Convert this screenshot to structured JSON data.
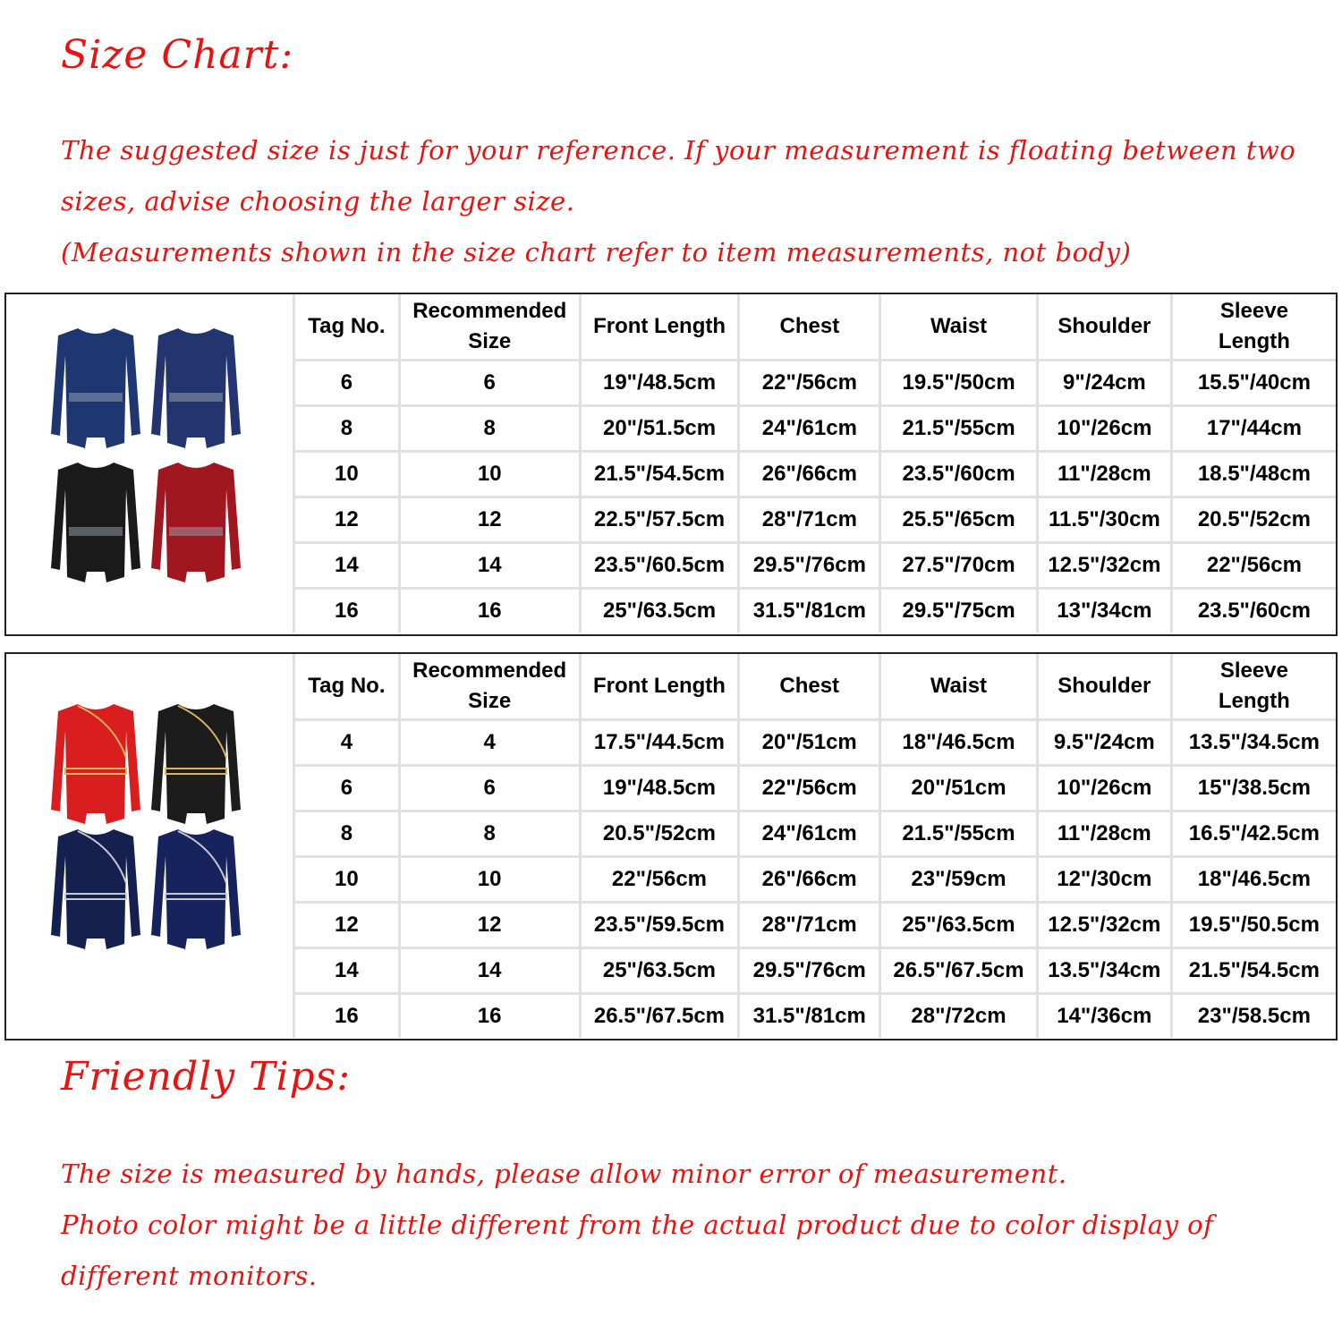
{
  "header": {
    "title": "Size Chart:",
    "intro_lines": [
      "The suggested size is just for your reference. If your measurement is floating between two",
      "sizes, advise choosing the larger size.",
      "(Measurements shown in the size chart refer to item measurements, not body)"
    ]
  },
  "colors": {
    "accent_red": "#e8120f",
    "grid_line": "#e0e0e0",
    "border": "#222222"
  },
  "tables": [
    {
      "product_image": "cold-shoulder sequin long-sleeve leotards in navy, navy (back), black, burgundy",
      "headers": [
        "Tag No.",
        "Recommended Size",
        "Front Length",
        "Chest",
        "Waist",
        "Shoulder",
        "Sleeve Length"
      ],
      "header_lines": [
        [
          "Tag No."
        ],
        [
          "Recommended",
          "Size"
        ],
        [
          "Front Length"
        ],
        [
          "Chest"
        ],
        [
          "Waist"
        ],
        [
          "Shoulder"
        ],
        [
          "Sleeve",
          "Length"
        ]
      ],
      "rows": [
        [
          "6",
          "6",
          "19\"/48.5cm",
          "22\"/56cm",
          "19.5\"/50cm",
          "9\"/24cm",
          "15.5\"/40cm"
        ],
        [
          "8",
          "8",
          "20\"/51.5cm",
          "24\"/61cm",
          "21.5\"/55cm",
          "10\"/26cm",
          "17\"/44cm"
        ],
        [
          "10",
          "10",
          "21.5\"/54.5cm",
          "26\"/66cm",
          "23.5\"/60cm",
          "11\"/28cm",
          "18.5\"/48cm"
        ],
        [
          "12",
          "12",
          "22.5\"/57.5cm",
          "28\"/71cm",
          "25.5\"/65cm",
          "11.5\"/30cm",
          "20.5\"/52cm"
        ],
        [
          "14",
          "14",
          "23.5\"/60.5cm",
          "29.5\"/76cm",
          "27.5\"/70cm",
          "12.5\"/32cm",
          "22\"/56cm"
        ],
        [
          "16",
          "16",
          "25\"/63.5cm",
          "31.5\"/81cm",
          "29.5\"/75cm",
          "13\"/34cm",
          "23.5\"/60cm"
        ]
      ]
    },
    {
      "product_image": "long-sleeve leotards with gold/silver piping in red, black, navy, navy (back)",
      "headers": [
        "Tag No.",
        "Recommended Size",
        "Front Length",
        "Chest",
        "Waist",
        "Shoulder",
        "Sleeve Length"
      ],
      "header_lines": [
        [
          "Tag No."
        ],
        [
          "Recommended",
          "Size"
        ],
        [
          "Front Length"
        ],
        [
          "Chest"
        ],
        [
          "Waist"
        ],
        [
          "Shoulder"
        ],
        [
          "Sleeve",
          "Length"
        ]
      ],
      "rows": [
        [
          "4",
          "4",
          "17.5\"/44.5cm",
          "20\"/51cm",
          "18\"/46.5cm",
          "9.5\"/24cm",
          "13.5\"/34.5cm"
        ],
        [
          "6",
          "6",
          "19\"/48.5cm",
          "22\"/56cm",
          "20\"/51cm",
          "10\"/26cm",
          "15\"/38.5cm"
        ],
        [
          "8",
          "8",
          "20.5\"/52cm",
          "24\"/61cm",
          "21.5\"/55cm",
          "11\"/28cm",
          "16.5\"/42.5cm"
        ],
        [
          "10",
          "10",
          "22\"/56cm",
          "26\"/66cm",
          "23\"/59cm",
          "12\"/30cm",
          "18\"/46.5cm"
        ],
        [
          "12",
          "12",
          "23.5\"/59.5cm",
          "28\"/71cm",
          "25\"/63.5cm",
          "12.5\"/32cm",
          "19.5\"/50.5cm"
        ],
        [
          "14",
          "14",
          "25\"/63.5cm",
          "29.5\"/76cm",
          "26.5\"/67.5cm",
          "13.5\"/34cm",
          "21.5\"/54.5cm"
        ],
        [
          "16",
          "16",
          "26.5\"/67.5cm",
          "31.5\"/81cm",
          "28\"/72cm",
          "14\"/36cm",
          "23\"/58.5cm"
        ]
      ]
    }
  ],
  "tips": {
    "title": "Friendly Tips:",
    "lines": [
      "The size is measured by hands, please allow minor error of measurement.",
      "Photo color might be a little different from the actual product due to color display of",
      "different monitors."
    ]
  },
  "garments": {
    "set1": [
      "#1f3770",
      "#23346e",
      "#1a1a1a",
      "#a01720"
    ],
    "set2": [
      "#d81e1e",
      "#1c1c1c",
      "#14204e",
      "#17235c"
    ]
  }
}
